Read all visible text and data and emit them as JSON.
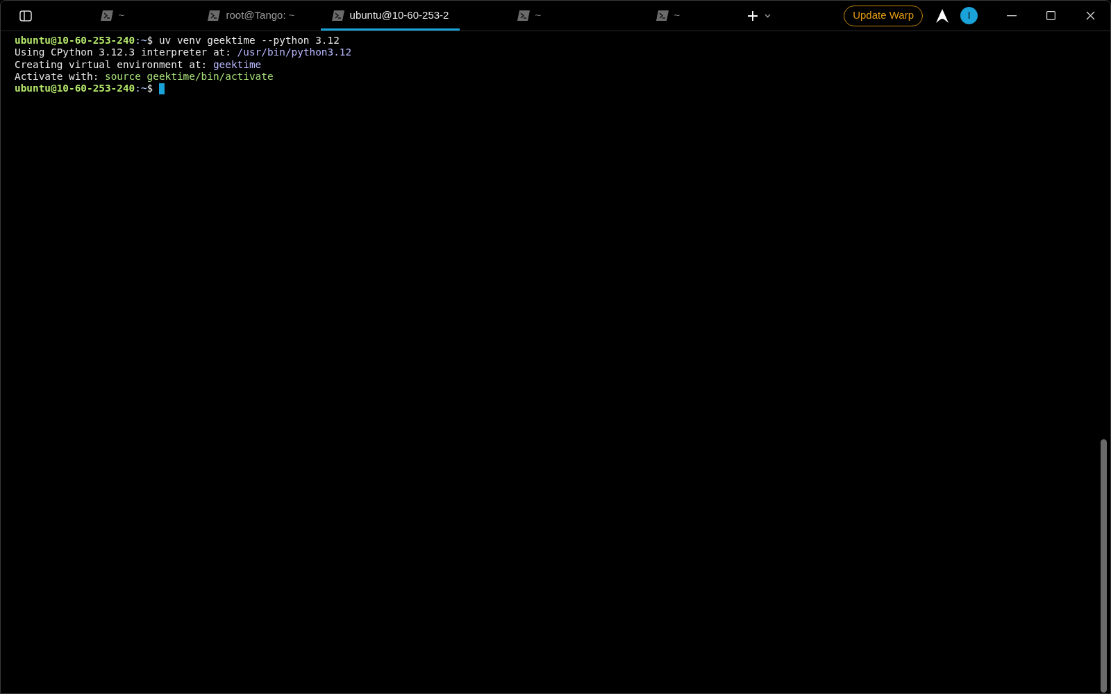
{
  "tabs": [
    {
      "label": "~",
      "selected": false
    },
    {
      "label": "root@Tango: ~",
      "selected": false
    },
    {
      "label": "ubuntu@10-60-253-2",
      "selected": true
    },
    {
      "label": "~",
      "selected": false
    },
    {
      "label": "~",
      "selected": false
    }
  ],
  "update_button": "Update Warp",
  "avatar_initial": "I",
  "terminal_lines": [
    {
      "kind": "prompt",
      "host": "ubuntu@10-60-253-240",
      "path": ":~",
      "symbol": "$",
      "command": "uv venv geektime --python 3.12",
      "cursor": false
    },
    {
      "kind": "output",
      "text": "Using CPython 3.12.3 interpreter at: ",
      "highlight": {
        "kind": "path",
        "text": "/usr/bin/python3.12"
      }
    },
    {
      "kind": "output",
      "text": "Creating virtual environment at: ",
      "highlight": {
        "kind": "path",
        "text": "geektime"
      }
    },
    {
      "kind": "output",
      "text": "Activate with: ",
      "highlight": {
        "kind": "command",
        "text": "source geektime/bin/activate"
      }
    },
    {
      "kind": "prompt",
      "host": "ubuntu@10-60-253-240",
      "path": ":~",
      "symbol": "$",
      "cursor": true
    }
  ]
}
